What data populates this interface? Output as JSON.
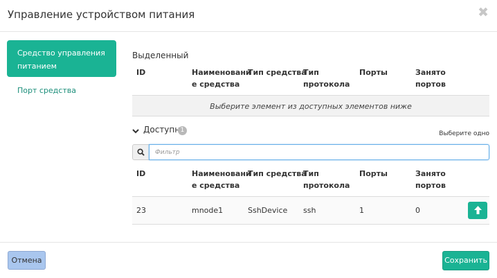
{
  "modal": {
    "title": "Управление устройством питания",
    "close_label": "✖"
  },
  "sidebar": {
    "items": [
      {
        "label_line1": "Средство управления",
        "label_line2": "питанием",
        "active": true
      },
      {
        "label": "Порт средства",
        "active": false
      }
    ]
  },
  "selected": {
    "title": "Выделенный",
    "columns": [
      {
        "line1": "ID",
        "line2": ""
      },
      {
        "line1": "Наименовани",
        "line2": "е средства"
      },
      {
        "line1": "Тип средства",
        "line2": ""
      },
      {
        "line1": "Тип",
        "line2": "протокола"
      },
      {
        "line1": "Порты",
        "line2": ""
      },
      {
        "line1": "Занято",
        "line2": "портов"
      }
    ],
    "empty_text": "Выберите элемент из доступных элементов ниже"
  },
  "available": {
    "title": "Доступно",
    "count": "1",
    "select_hint": "Выберите одно",
    "filter_placeholder": "Фильтр",
    "columns": [
      {
        "line1": "ID",
        "line2": ""
      },
      {
        "line1": "Наименовани",
        "line2": "е средства"
      },
      {
        "line1": "Тип средства",
        "line2": ""
      },
      {
        "line1": "Тип",
        "line2": "протокола"
      },
      {
        "line1": "Порты",
        "line2": ""
      },
      {
        "line1": "Занято",
        "line2": "портов"
      }
    ],
    "rows": [
      {
        "id": "23",
        "name": "mnode1",
        "type": "SshDevice",
        "protocol": "ssh",
        "ports": "1",
        "used_ports": "0"
      }
    ]
  },
  "footer": {
    "cancel_label": "Отмена",
    "save_label": "Сохранить"
  },
  "colors": {
    "accent": "#1ab394",
    "cancel_bg": "#a9c6ee"
  }
}
